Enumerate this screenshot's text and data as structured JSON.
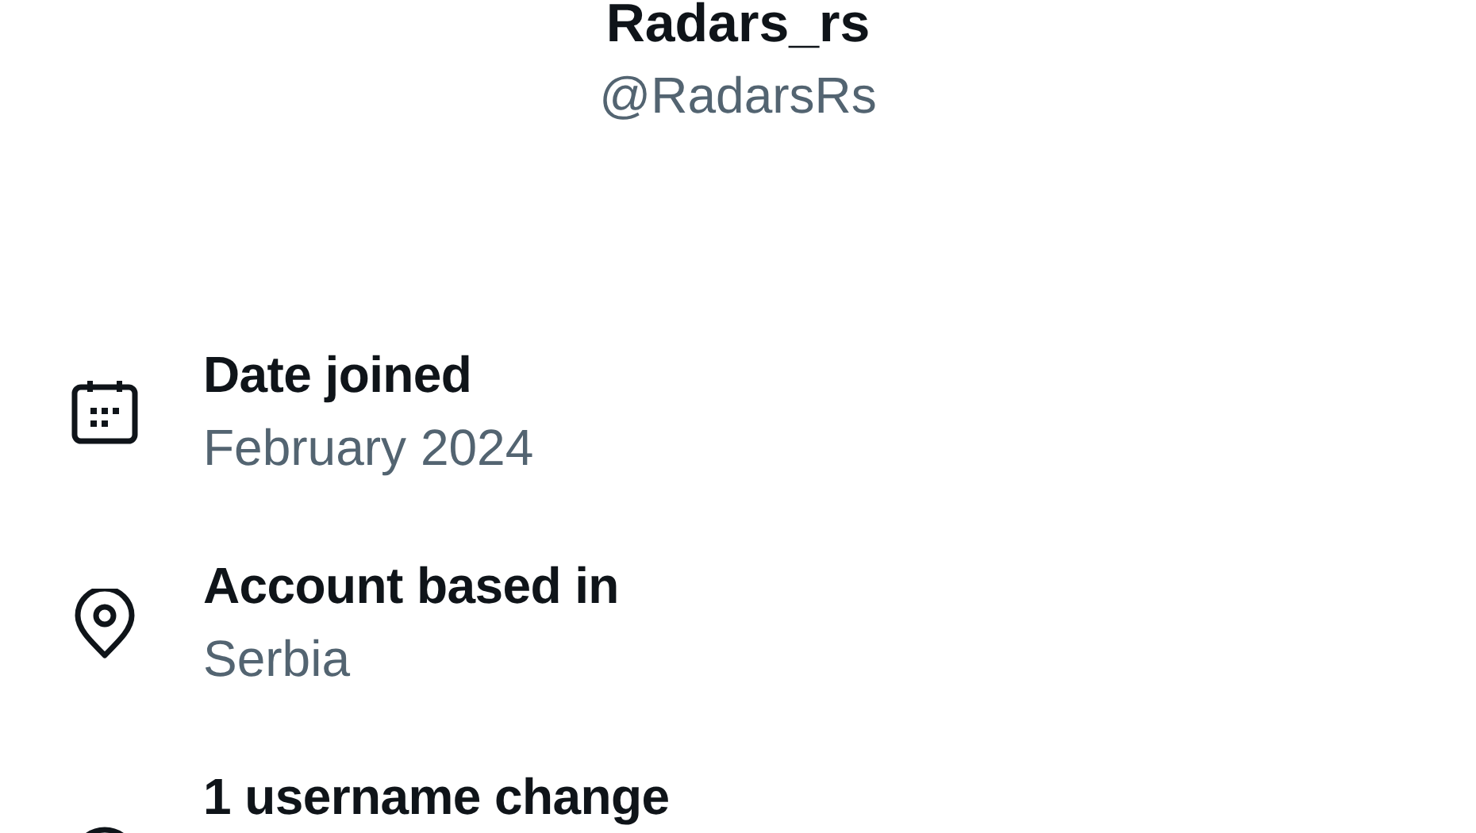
{
  "profile": {
    "name": "Radars_rs",
    "handle": "@RadarsRs"
  },
  "details": [
    {
      "kind": "calendar",
      "title": "Date joined",
      "value": "February 2024"
    },
    {
      "kind": "location",
      "title": "Account based in",
      "value": "Serbia"
    },
    {
      "kind": "history",
      "title": "1 username change"
    }
  ]
}
